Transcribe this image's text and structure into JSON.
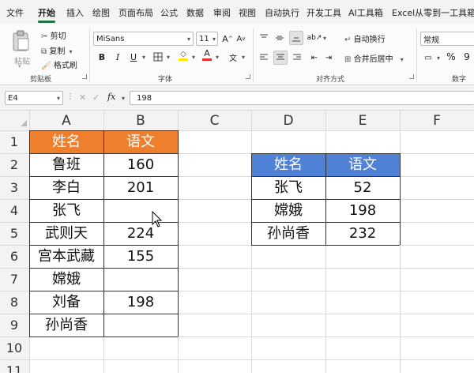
{
  "menu_tabs": [
    "文件",
    "开始",
    "插入",
    "绘图",
    "页面布局",
    "公式",
    "数据",
    "审阅",
    "视图",
    "自动执行",
    "开发工具",
    "AI工具箱",
    "Excel从零到一工具箱"
  ],
  "ribbon": {
    "clipboard": {
      "paste": "粘贴",
      "cut": "剪切",
      "copy": "复制",
      "format_painter": "格式刷",
      "group": "剪贴板"
    },
    "font": {
      "name": "MiSans",
      "size": "11",
      "bold": "B",
      "italic": "I",
      "underline": "U",
      "grow": "A",
      "shrink": "A",
      "font_color_letter": "A",
      "group": "字体"
    },
    "alignment": {
      "wrap": "自动换行",
      "merge": "合并后居中",
      "group": "对齐方式"
    },
    "number": {
      "format": "常规",
      "percent": "%",
      "comma": "9",
      "group": "数字"
    }
  },
  "formula_bar": {
    "name_box": "E4",
    "fx": "fx",
    "value": "198"
  },
  "columns": [
    "A",
    "B",
    "C",
    "D",
    "E",
    "F"
  ],
  "rows": [
    "1",
    "2",
    "3",
    "4",
    "5",
    "6",
    "7",
    "8",
    "9",
    "10",
    "11"
  ],
  "table1": {
    "headers": [
      "姓名",
      "语文"
    ],
    "rows": [
      [
        "鲁班",
        "160"
      ],
      [
        "李白",
        "201"
      ],
      [
        "张飞",
        ""
      ],
      [
        "武则天",
        "224"
      ],
      [
        "宫本武藏",
        "155"
      ],
      [
        "嫦娥",
        ""
      ],
      [
        "刘备",
        "198"
      ],
      [
        "孙尚香",
        ""
      ]
    ]
  },
  "table2": {
    "headers": [
      "姓名",
      "语文"
    ],
    "rows": [
      [
        "张飞",
        "52"
      ],
      [
        "嫦娥",
        "198"
      ],
      [
        "孙尚香",
        "232"
      ]
    ]
  },
  "colors": {
    "table1_header": "#ee7f2d",
    "table2_header": "#4f81d6",
    "accent": "#217346",
    "font_color": "#e03030",
    "highlight": "#ffe600"
  }
}
